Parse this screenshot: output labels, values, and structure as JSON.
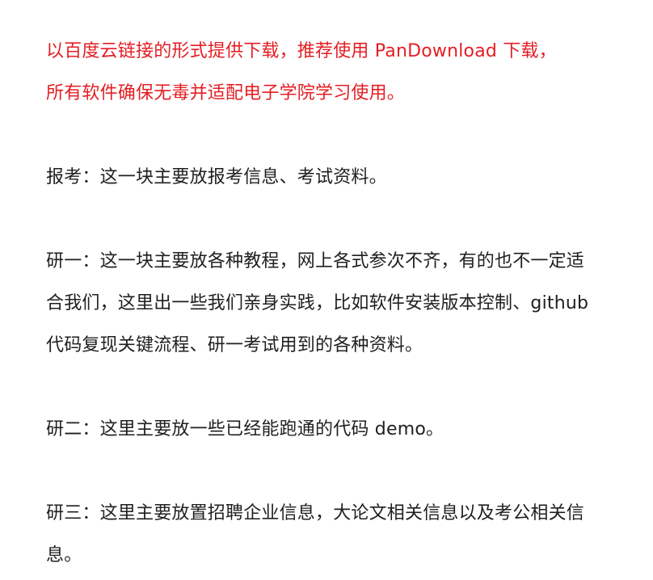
{
  "notice": {
    "lines": [
      "以百度云链接的形式提供下载，推荐使用 PanDownload 下载，",
      "所有软件确保无毒并适配电子学院学习使用。"
    ]
  },
  "sections": [
    {
      "id": "baokao",
      "lines": [
        "报考：这一块主要放报考信息、考试资料。"
      ]
    },
    {
      "id": "yanyi",
      "lines": [
        "研一：这一块主要放各种教程，网上各式参次不齐，有的也不一定适",
        "合我们，这里出一些我们亲身实践，比如软件安装版本控制、github",
        "代码复现关键流程、研一考试用到的各种资料。"
      ]
    },
    {
      "id": "yaner",
      "lines": [
        "研二：这里主要放一些已经能跑通的代码 demo。"
      ]
    },
    {
      "id": "yansan",
      "lines": [
        "研三：这里主要放置招聘企业信息，大论文相关信息以及考公相关信",
        "息。"
      ]
    }
  ]
}
